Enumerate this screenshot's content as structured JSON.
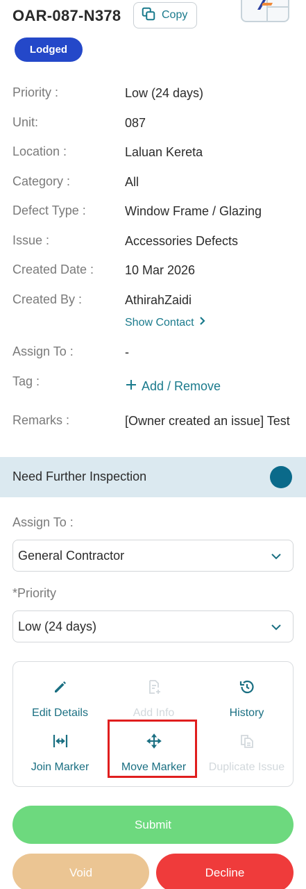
{
  "header": {
    "issue_id": "OAR-087-N378",
    "copy_label": "Copy",
    "status": "Lodged"
  },
  "details": [
    {
      "label": "Priority :",
      "value": "Low (24 days)"
    },
    {
      "label": "Unit:",
      "value": "087"
    },
    {
      "label": "Location :",
      "value": "Laluan Kereta"
    },
    {
      "label": "Category :",
      "value": "All"
    },
    {
      "label": "Defect Type :",
      "value": "Window Frame / Glazing"
    },
    {
      "label": "Issue :",
      "value": "Accessories Defects"
    },
    {
      "label": "Created Date :",
      "value": "10 Mar 2026"
    },
    {
      "label": "Created By :",
      "value": "AthirahZaidi"
    },
    {
      "label": "Assign To :",
      "value": "-"
    },
    {
      "label": "Tag :",
      "value": ""
    },
    {
      "label": "Remarks :",
      "value": "[Owner created an issue] Test"
    }
  ],
  "show_contact_label": "Show Contact",
  "tag_action_label": "Add / Remove",
  "inspection": {
    "label": "Need Further Inspection"
  },
  "form": {
    "assign_label": "Assign To :",
    "assign_value": "General Contractor",
    "priority_label": "*Priority",
    "priority_value": "Low (24 days)"
  },
  "actions": [
    {
      "label": "Edit Details",
      "icon": "pencil-icon",
      "enabled": true
    },
    {
      "label": "Add Info",
      "icon": "add-document-icon",
      "enabled": false
    },
    {
      "label": "History",
      "icon": "history-icon",
      "enabled": true
    },
    {
      "label": "Join Marker",
      "icon": "join-marker-icon",
      "enabled": true
    },
    {
      "label": "Move Marker",
      "icon": "move-icon",
      "enabled": true
    },
    {
      "label": "Duplicate Issue",
      "icon": "duplicate-icon",
      "enabled": false
    }
  ],
  "buttons": {
    "submit": "Submit",
    "void": "Void",
    "decline": "Decline"
  },
  "colors": {
    "accent": "#1a7a8c",
    "status_badge": "#2448c9",
    "submit": "#6dd97e",
    "void": "#ebc593",
    "decline": "#ef3b3b",
    "highlight": "#e01e1e"
  }
}
